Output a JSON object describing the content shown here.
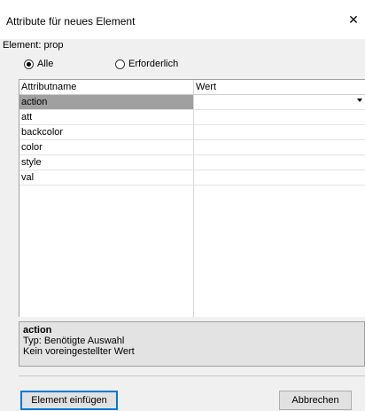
{
  "window": {
    "title": "Attribute für neues Element",
    "close_glyph": "✕"
  },
  "element_label": "Element: prop",
  "filter": {
    "options": [
      {
        "label": "Alle",
        "checked": true
      },
      {
        "label": "Erforderlich",
        "checked": false
      }
    ]
  },
  "grid": {
    "columns": [
      "Attributname",
      "Wert"
    ],
    "rows": [
      {
        "name": "action",
        "value": "",
        "selected": true
      },
      {
        "name": "att",
        "value": ""
      },
      {
        "name": "backcolor",
        "value": ""
      },
      {
        "name": "color",
        "value": ""
      },
      {
        "name": "style",
        "value": ""
      },
      {
        "name": "val",
        "value": ""
      }
    ]
  },
  "info": {
    "title": "action",
    "line1": "Typ: Benötigte Auswahl",
    "line2": "Kein voreingestellter Wert"
  },
  "buttons": {
    "insert": "Element einfügen",
    "cancel": "Abbrechen"
  },
  "colors": {
    "selected_row": "#a0a0a0",
    "default_button_border": "#0078d7",
    "background": "#f0f0f0"
  }
}
